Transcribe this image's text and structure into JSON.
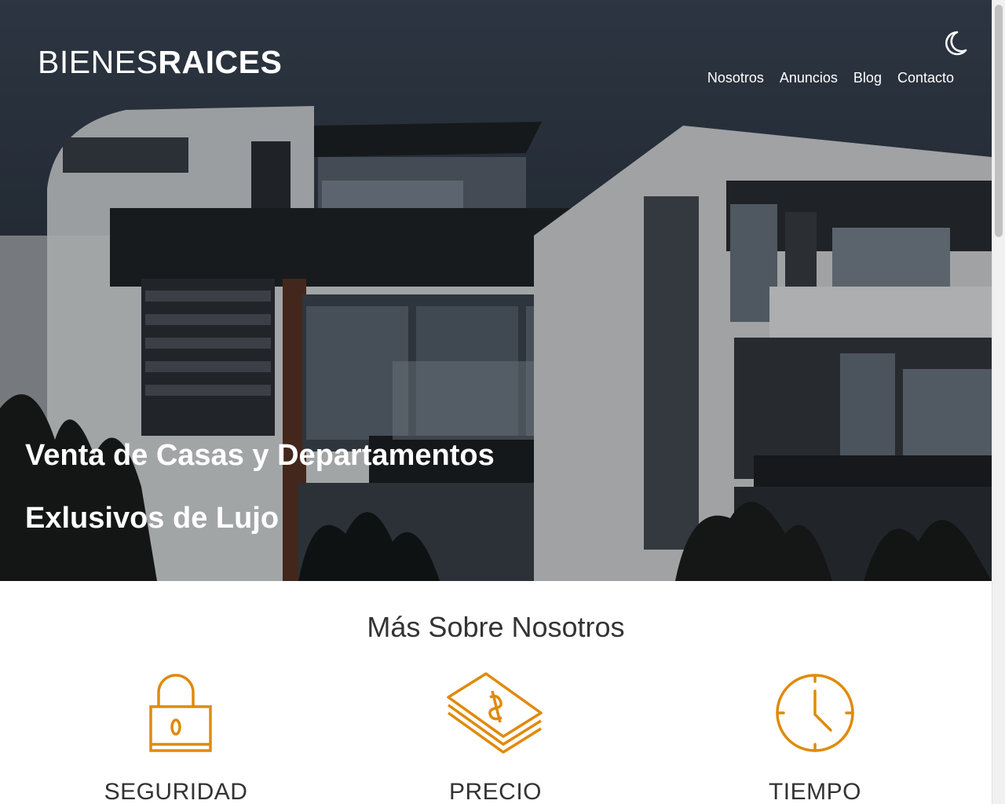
{
  "brand": {
    "light": "BIENES",
    "bold": "RAICES"
  },
  "nav": {
    "items": [
      {
        "label": "Nosotros"
      },
      {
        "label": "Anuncios"
      },
      {
        "label": "Blog"
      },
      {
        "label": "Contacto"
      }
    ]
  },
  "hero": {
    "line1": "Venta de Casas y Departamentos",
    "line2": "Exlusivos de Lujo"
  },
  "about": {
    "title": "Más Sobre Nosotros",
    "features": [
      {
        "title": "SEGURIDAD",
        "icon": "lock-icon"
      },
      {
        "title": "PRECIO",
        "icon": "money-icon"
      },
      {
        "title": "TIEMPO",
        "icon": "clock-icon"
      }
    ]
  },
  "colors": {
    "accent": "#e08a0b",
    "text": "#333333",
    "white": "#ffffff"
  }
}
